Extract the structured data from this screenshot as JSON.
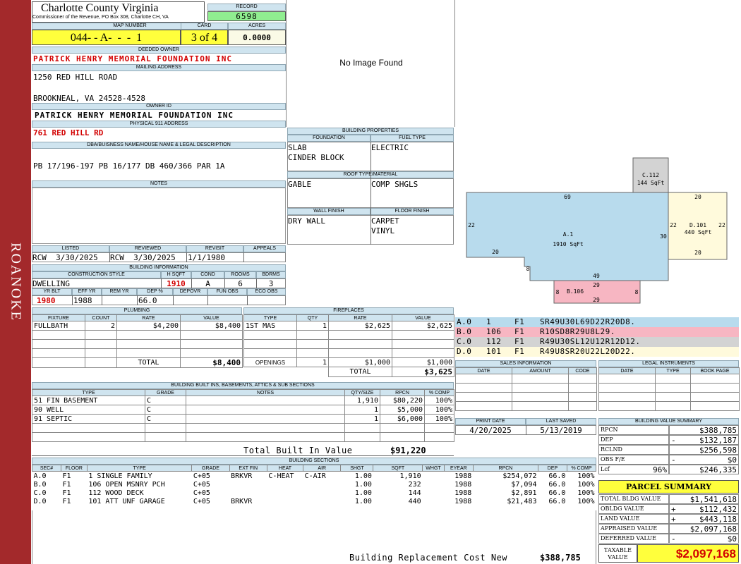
{
  "side_label": "ROANOKE",
  "header": {
    "county": "Charlotte County Virginia",
    "commissioner": "Commissioner of the Revenue, PO Box 308, Charlotte CH, VA",
    "record_label": "RECORD",
    "record": "6598",
    "map_number_label": "MAP NUMBER",
    "map_number": "044- - A-  -  -  1",
    "card_label": "CARD",
    "card": "3 of 4",
    "acres_label": "ACRES",
    "acres": "0.0000"
  },
  "owner": {
    "deeded_owner_label": "DEEDED OWNER",
    "deeded_owner": "PATRICK HENRY MEMORIAL FOUNDATION INC",
    "mailing_label": "MAILING ADDRESS",
    "mailing_line1": "1250 RED HILL ROAD",
    "mailing_line2": "BROOKNEAL, VA 24528-4528",
    "owner_id_label": "OWNER ID",
    "owner_id": "PATRICK HENRY MEMORIAL FOUNDATION INC",
    "physical_label": "PHYSICAL 911 ADDRESS",
    "physical": "761 RED HILL RD",
    "dba_label": "DBA/BUISNESS NAME/HOUSE NAME & LEGAL DESCRIPTION",
    "legal": "PB 17/196-197 PB 16/177 DB 460/366 PAR 1A",
    "notes_label": "NOTES"
  },
  "photo": {
    "no_image": "No Image Found"
  },
  "building_properties": {
    "title": "BUILDING PROPERTIES",
    "foundation_label": "FOUNDATION",
    "foundation": [
      "SLAB",
      "CINDER BLOCK"
    ],
    "fuel_label": "FUEL TYPE",
    "fuel": [
      "ELECTRIC"
    ],
    "roof_label": "ROOF TYPE/MATERIAL",
    "roof_type": "GABLE",
    "roof_material": "COMP SHGLS",
    "wall_label": "WALL FINISH",
    "wall": [
      "DRY WALL"
    ],
    "floor_label": "FLOOR FINISH",
    "floor": [
      "CARPET",
      "VINYL"
    ]
  },
  "review": {
    "listed_label": "LISTED",
    "listed": "RCW  3/30/2025",
    "reviewed_label": "REVIEWED",
    "reviewed": "RCW  3/30/2025",
    "revisit_label": "REVISIT",
    "revisit": "1/1/1980",
    "appeals_label": "APPEALS",
    "appeals": ""
  },
  "building_info": {
    "title": "BUILDING INFORMATION",
    "style_label": "CONSTRUCTION STYLE",
    "style": "DWELLING",
    "hsqft_label": "H SQFT",
    "hsqft": "1910",
    "cond_label": "COND",
    "cond": "A",
    "rooms_label": "ROOMS",
    "rooms": "6",
    "bdrms_label": "BDRMS",
    "bdrms": "3",
    "yrblt_label": "YR BLT",
    "yrblt": "1980",
    "effyr_label": "EFF YR",
    "effyr": "1988",
    "remyr_label": "REM YR",
    "remyr": "",
    "dep_label": "DEP %",
    "dep": "66.0",
    "depovr_label": "DEPOVR",
    "depovr": "",
    "funobs_label": "FUN OBS",
    "funobs": "",
    "ecoobs_label": "ECO OBS",
    "ecoobs": ""
  },
  "plumbing": {
    "title": "PLUMBING",
    "headers": [
      "FIXTURE",
      "COUNT",
      "RATE",
      "VALUE"
    ],
    "rows": [
      [
        "FULLBATH",
        "2",
        "$4,200",
        "$8,400"
      ]
    ],
    "total_label": "TOTAL",
    "total": "$8,400"
  },
  "fireplaces": {
    "title": "FIREPLACES",
    "headers": [
      "TYPE",
      "QTY",
      "RATE",
      "VALUE"
    ],
    "rows": [
      [
        "1ST MAS",
        "1",
        "$2,625",
        "$2,625"
      ]
    ],
    "openings_label": "OPENINGS",
    "openings": [
      "1",
      "$1,000",
      "$1,000"
    ],
    "total_label": "TOTAL",
    "total": "$3,625"
  },
  "built_ins": {
    "title": "BUILDING BUILT INS, BASEMENTS, ATTICS & SUB SECTIONS",
    "headers": [
      "TYPE",
      "GRADE",
      "NOTES",
      "QTY/SIZE",
      "RPCN",
      "% COMP"
    ],
    "rows": [
      [
        "51 FIN BASEMENT",
        "C",
        "",
        "1,910",
        "$80,220",
        "100%"
      ],
      [
        "90 WELL",
        "C",
        "",
        "1",
        "$5,000",
        "100%"
      ],
      [
        "91 SEPTIC",
        "C",
        "",
        "1",
        "$6,000",
        "100%"
      ]
    ],
    "total_label": "Total Built In Value",
    "total": "$91,220"
  },
  "sections": {
    "title": "BUILDING SECTIONS",
    "headers": [
      "SEC#",
      "FLOOR",
      "TYPE",
      "GRADE",
      "EXT FIN",
      "HEAT",
      "AIR",
      "SHGT",
      "SQFT",
      "WHGT",
      "EYEAR",
      "RPCN",
      "DEP",
      "% COMP"
    ],
    "rows": [
      [
        "A.0",
        "F1",
        "1 SINGLE FAMILY",
        "C+05",
        "BRKVR",
        "C-HEAT",
        "C-AIR",
        "1.00",
        "1,910",
        "",
        "1988",
        "$254,072",
        "66.0",
        "100%"
      ],
      [
        "B.0",
        "F1",
        "106 OPEN MSNRY PCH",
        "C+05",
        "",
        "",
        "",
        "1.00",
        "232",
        "",
        "1988",
        "$7,094",
        "66.0",
        "100%"
      ],
      [
        "C.0",
        "F1",
        "112 WOOD DECK",
        "C+05",
        "",
        "",
        "",
        "1.00",
        "144",
        "",
        "1988",
        "$2,891",
        "66.0",
        "100%"
      ],
      [
        "D.0",
        "F1",
        "101 ATT UNF GARAGE",
        "C+05",
        "BRKVR",
        "",
        "",
        "1.00",
        "440",
        "",
        "1988",
        "$21,483",
        "66.0",
        "100%"
      ]
    ],
    "brcn_label": "Building Replacement Cost New",
    "brcn": "$388,785"
  },
  "sketch": {
    "labels": {
      "c112": "C.112",
      "c112_area": "144 SqFt",
      "a1": "A.1",
      "a1_area": "1910 SqFt",
      "d101": "D.101",
      "d101_area": "440 SqFt",
      "b106": "B.106"
    },
    "dims": {
      "a_top": "69",
      "a_left": "22",
      "a_bl": "20",
      "a_step": "8",
      "a_bot": "49",
      "a_right": "30",
      "d_top": "20",
      "d_left": "22",
      "d_right": "22",
      "d_bot": "20",
      "b_top": "29",
      "b_left": "8",
      "b_right": "8",
      "b_bot": "29"
    },
    "colors": {
      "a": "#b8dbed",
      "b": "#f7b6c2",
      "c": "#d3d3d3",
      "d": "#fffadc"
    },
    "vectors": [
      {
        "sec": "A.0",
        "num": "1",
        "fl": "F1",
        "vec": "SR49U30L69D22R20D8.",
        "color": "#b8dbed"
      },
      {
        "sec": "B.0",
        "num": "106",
        "fl": "F1",
        "vec": "R10SD8R29U8L29.",
        "color": "#f7b6c2"
      },
      {
        "sec": "C.0",
        "num": "112",
        "fl": "F1",
        "vec": "R49U30SL12U12R12D12.",
        "color": "#d3d3d3"
      },
      {
        "sec": "D.0",
        "num": "101",
        "fl": "F1",
        "vec": "R49U8SR20U22L20D22.",
        "color": "#fffadc"
      }
    ]
  },
  "sales": {
    "title": "SALES INFORMATION",
    "headers": [
      "DATE",
      "AMOUNT",
      "CODE"
    ]
  },
  "legal_instruments": {
    "title": "LEGAL INSTRUMENTS",
    "headers": [
      "DATE",
      "TYPE",
      "BOOK PAGE"
    ]
  },
  "dates": {
    "print_label": "PRINT DATE",
    "print": "4/20/2025",
    "saved_label": "LAST SAVED",
    "saved": "5/13/2019"
  },
  "value_summary": {
    "title": "BUILDING VALUE SUMMARY",
    "rows": [
      {
        "label": "RPCN",
        "sign": "",
        "value": "$388,785"
      },
      {
        "label": "DEP",
        "sign": "-",
        "value": "$132,187"
      },
      {
        "label": "RCLND",
        "sign": "",
        "value": "$256,598"
      },
      {
        "label": "OBS F/E",
        "sign": "-",
        "value": "$0"
      },
      {
        "label": "Lcf",
        "pct": "96%",
        "sign": "",
        "value": "$246,335"
      }
    ]
  },
  "parcel_summary": {
    "title": "PARCEL SUMMARY",
    "rows": [
      {
        "label": "TOTAL BLDG VALUE",
        "sign": "",
        "value": "$1,541,618"
      },
      {
        "label": "OBLDG VALUE",
        "sign": "+",
        "value": "$112,432"
      },
      {
        "label": "LAND VALUE",
        "sign": "+",
        "value": "$443,118"
      },
      {
        "label": "APPRAISED VALUE",
        "sign": "",
        "value": "$2,097,168"
      },
      {
        "label": "DEFERRED VALUE",
        "sign": "-",
        "value": "$0"
      }
    ],
    "taxable_label_1": "TAXABLE",
    "taxable_label_2": "VALUE",
    "taxable": "$2,097,168"
  }
}
